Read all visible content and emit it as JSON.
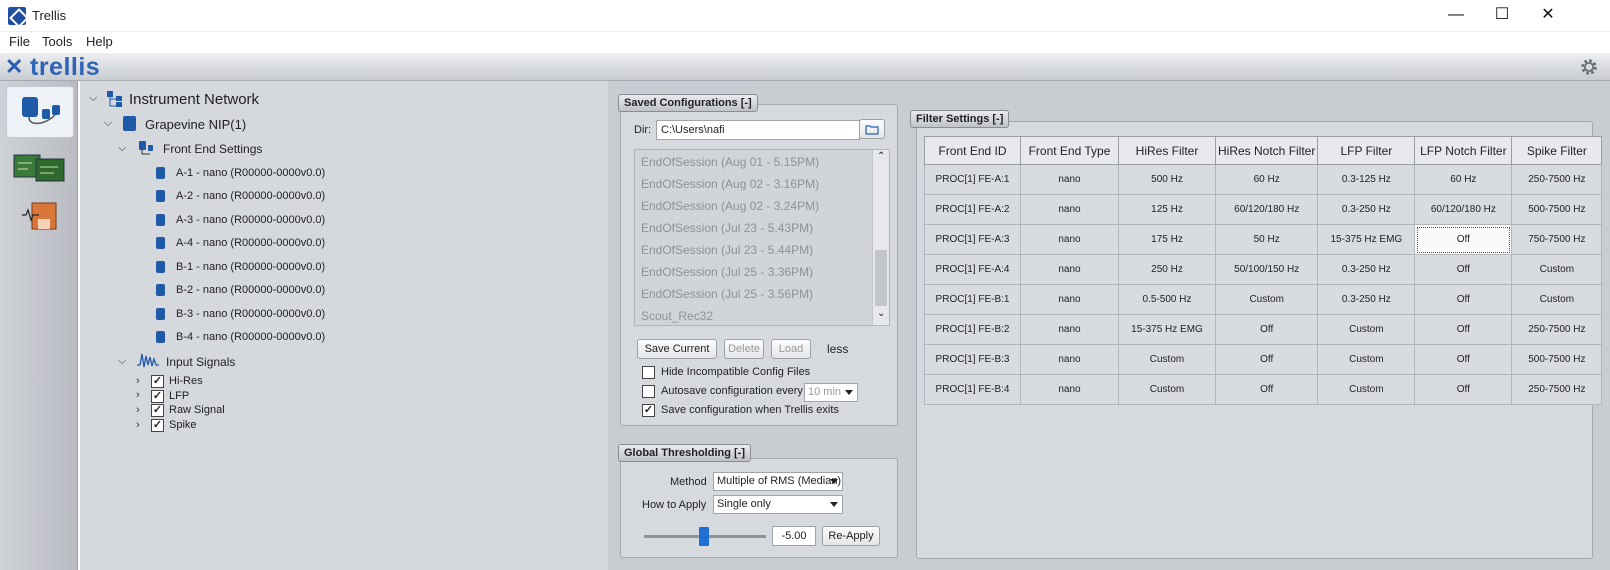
{
  "window": {
    "title": "Trellis",
    "minimize": "—",
    "maximize": "☐",
    "close": "✕"
  },
  "menu": [
    "File",
    "Tools",
    "Help"
  ],
  "brand": {
    "mark": "✕",
    "name": "trellis"
  },
  "tree": {
    "root": "Instrument Network",
    "nip": "Grapevine NIP(1)",
    "front_end_settings": "Front End Settings",
    "front_ends": [
      "A-1 - nano (R00000-0000v0.0)",
      "A-2 - nano (R00000-0000v0.0)",
      "A-3 - nano (R00000-0000v0.0)",
      "A-4 - nano (R00000-0000v0.0)",
      "B-1 - nano (R00000-0000v0.0)",
      "B-2 - nano (R00000-0000v0.0)",
      "B-3 - nano (R00000-0000v0.0)",
      "B-4 - nano (R00000-0000v0.0)"
    ],
    "input_signals": "Input Signals",
    "signals": [
      "Hi-Res",
      "LFP",
      "Raw Signal",
      "Spike"
    ]
  },
  "saved_configs": {
    "title": "Saved Configurations  [-]",
    "dir_label": "Dir:",
    "dir_value": "C:\\Users\\nafi",
    "items": [
      "EndOfSession (Aug 01 - 5.15PM)",
      "EndOfSession (Aug 02 - 3.16PM)",
      "EndOfSession (Aug 02 - 3.24PM)",
      "EndOfSession (Jul 23 - 5.43PM)",
      "EndOfSession (Jul 23 - 5.44PM)",
      "EndOfSession (Jul 25 - 3.36PM)",
      "EndOfSession (Jul 25 - 3.56PM)",
      "Scout_Rec32"
    ],
    "save_current": "Save Current",
    "delete": "Delete",
    "load": "Load",
    "less": "less",
    "hide_incompatible": "Hide Incompatible Config Files",
    "autosave": "Autosave configuration every",
    "autosave_interval": "10 min",
    "save_on_exit": "Save configuration when Trellis exits"
  },
  "thresholding": {
    "title": "Global Thresholding  [-]",
    "method_label": "Method",
    "method_value": "Multiple of RMS (Median)",
    "apply_label": "How to Apply",
    "apply_value": "Single only",
    "threshold_value": "-5.00",
    "reapply": "Re-Apply"
  },
  "filter_settings": {
    "title": "Filter Settings  [-]",
    "headers": [
      "Front End ID",
      "Front End Type",
      "HiRes Filter",
      "HiRes Notch Filter",
      "LFP Filter",
      "LFP Notch Filter",
      "Spike Filter"
    ],
    "rows": [
      [
        "PROC[1] FE-A:1",
        "nano",
        "500 Hz",
        "60 Hz",
        "0.3-125 Hz",
        "60 Hz",
        "250-7500 Hz"
      ],
      [
        "PROC[1] FE-A:2",
        "nano",
        "125 Hz",
        "60/120/180 Hz",
        "0.3-250 Hz",
        "60/120/180 Hz",
        "500-7500 Hz"
      ],
      [
        "PROC[1] FE-A:3",
        "nano",
        "175 Hz",
        "50 Hz",
        "15-375 Hz EMG",
        "Off",
        "750-7500 Hz"
      ],
      [
        "PROC[1] FE-A:4",
        "nano",
        "250 Hz",
        "50/100/150 Hz",
        "0.3-250 Hz",
        "Off",
        "Custom"
      ],
      [
        "PROC[1] FE-B:1",
        "nano",
        "0.5-500 Hz",
        "Custom",
        "0.3-250 Hz",
        "Off",
        "Custom"
      ],
      [
        "PROC[1] FE-B:2",
        "nano",
        "15-375 Hz EMG",
        "Off",
        "Custom",
        "Off",
        "250-7500 Hz"
      ],
      [
        "PROC[1] FE-B:3",
        "nano",
        "Custom",
        "Off",
        "Custom",
        "Off",
        "500-7500 Hz"
      ],
      [
        "PROC[1] FE-B:4",
        "nano",
        "Custom",
        "Off",
        "Custom",
        "Off",
        "250-7500 Hz"
      ]
    ],
    "selected_cell": {
      "row": 2,
      "col": 5
    }
  },
  "colors": {
    "accent": "#1f5aa8",
    "slider": "#1f6fd6"
  }
}
